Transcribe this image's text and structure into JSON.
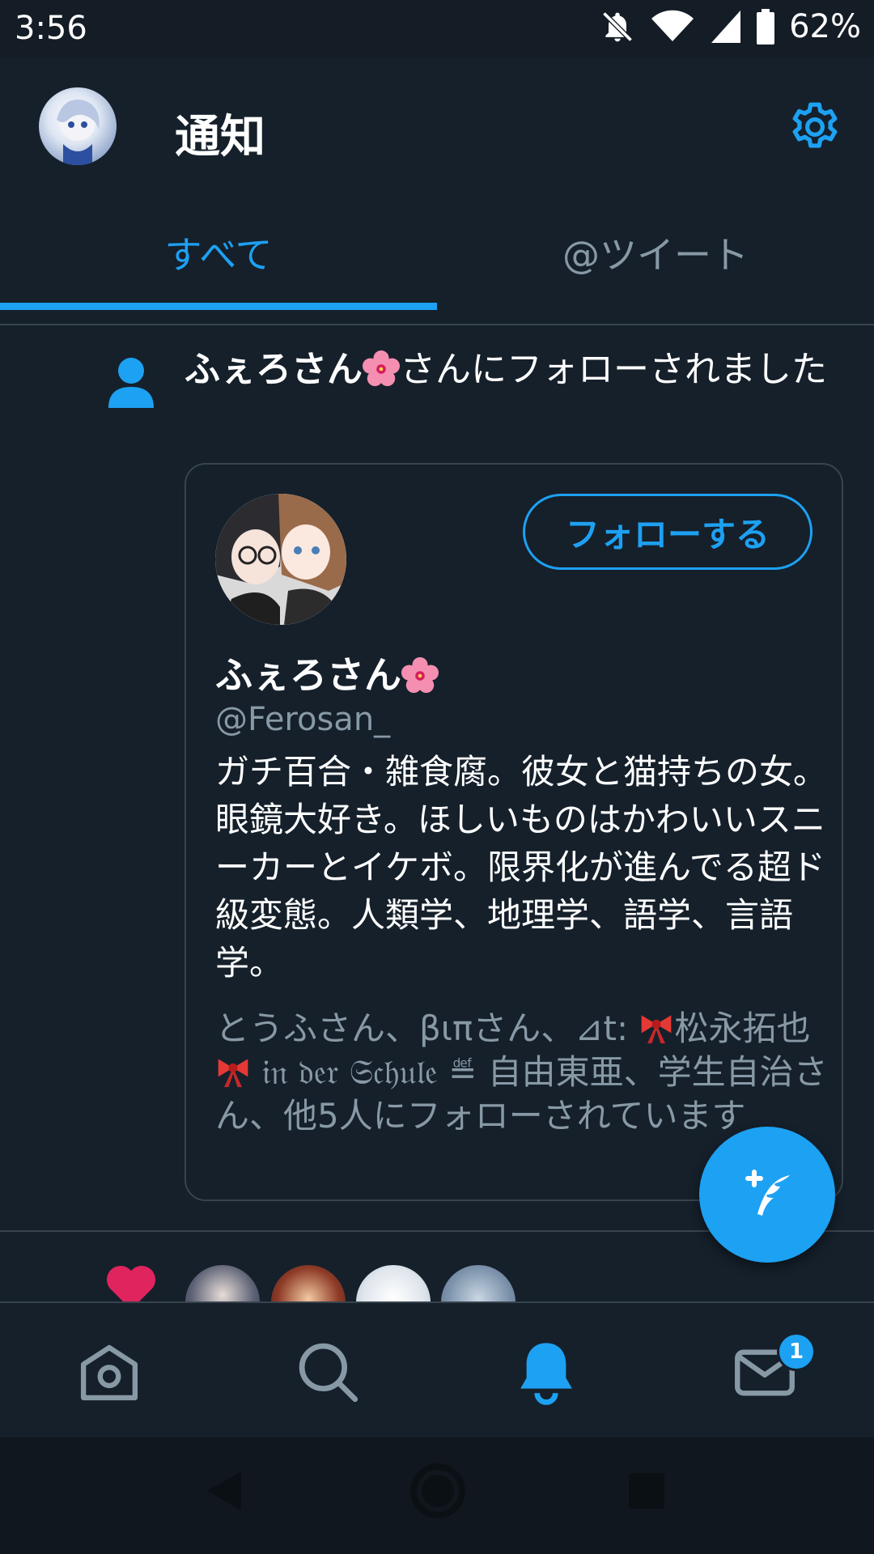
{
  "status_bar": {
    "time": "3:56",
    "battery": "62%",
    "icons": [
      "notifications-off-icon",
      "wifi-icon",
      "signal-icon",
      "battery-icon"
    ]
  },
  "header": {
    "title": "通知",
    "icons": [
      "avatar",
      "gear-icon"
    ]
  },
  "tabs": [
    {
      "label": "すべて",
      "active": true
    },
    {
      "label": "@ツイート",
      "active": false
    }
  ],
  "follow_notification": {
    "actor": "ふぇろさん",
    "action": "さんにフォローされました",
    "card": {
      "name": "ふぇろさん",
      "handle": "@Ferosan_",
      "follow_label": "フォローする",
      "bio": "ガチ百合・雑食腐。彼女と猫持ちの女。眼鏡大好き。ほしいものはかわいいスニーカーとイケボ。限界化が進んでる超ド級変態。人類学、地理学、語学、言語学。",
      "followers_part1": "とうふさん、βιπさん、⊿t: ",
      "followers_part2": "松永拓也",
      "followers_part3": " 𝔦𝔫 𝔡𝔢𝔯 𝔖𝔠𝔥𝔲𝔩𝔢 ≝ 自由東亜、学生自治さん、他5人にフォローされています"
    }
  },
  "bottom_nav": {
    "items": [
      "home-icon",
      "search-icon",
      "notifications-icon",
      "messages-icon"
    ],
    "messages_badge": "1"
  },
  "colors": {
    "background": "#15202b",
    "accent": "#1da1f2",
    "secondary_text": "#8899a6",
    "like": "#e0245e"
  }
}
